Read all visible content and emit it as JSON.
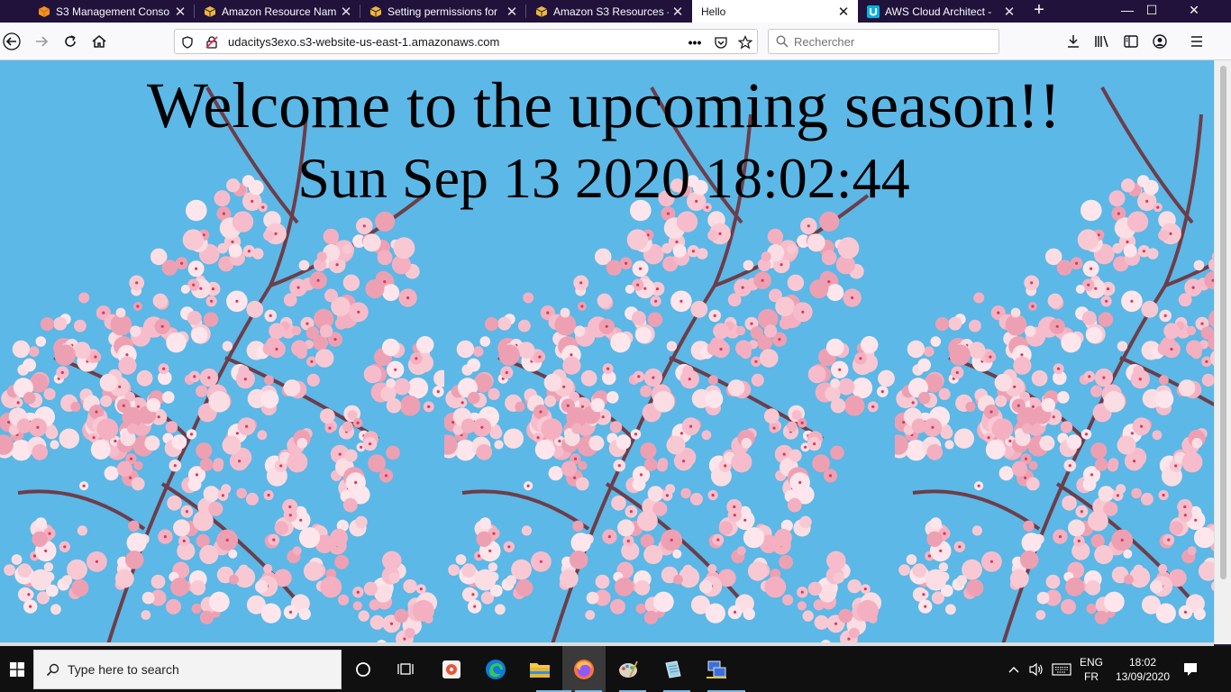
{
  "browser": {
    "tabs": [
      {
        "title": "S3 Management Conso",
        "icon": "aws-box-icon",
        "active": false
      },
      {
        "title": "Amazon Resource Nam",
        "icon": "aws-cube-icon",
        "active": false
      },
      {
        "title": "Setting permissions for",
        "icon": "aws-cube-icon",
        "active": false
      },
      {
        "title": "Amazon S3 Resources -",
        "icon": "aws-cube-icon",
        "active": false
      },
      {
        "title": "Hello",
        "icon": "",
        "active": true
      },
      {
        "title": "AWS Cloud Architect - ",
        "icon": "udacity-icon",
        "active": false
      }
    ],
    "url": "udacitys3exo.s3-website-us-east-1.amazonaws.com",
    "search_placeholder": "Rechercher"
  },
  "page": {
    "headline": "Welcome to the upcoming season!!",
    "datetime": "Sun Sep 13 2020 18:02:44"
  },
  "taskbar": {
    "search_placeholder": "Type here to search",
    "language": "ENG",
    "layout": "FR",
    "time": "18:02",
    "date": "13/09/2020"
  },
  "colors": {
    "tabstrip": "#20123a",
    "sky": "#5cb8e6",
    "blossom": "#f4b6c2",
    "taskbar": "#101010"
  }
}
